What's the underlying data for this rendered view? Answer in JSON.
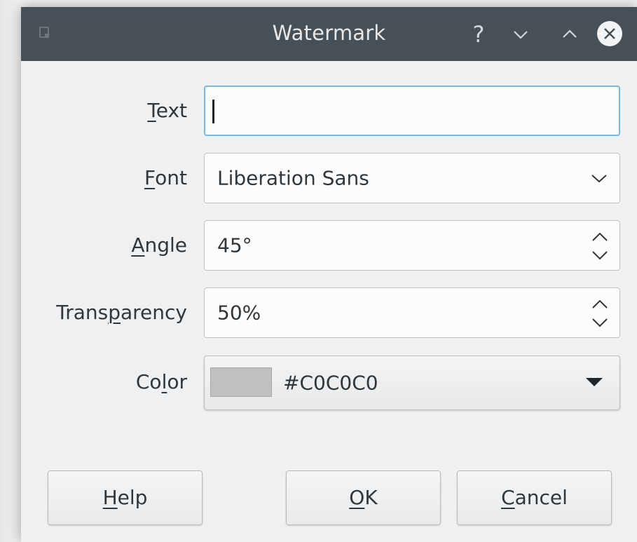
{
  "window": {
    "title": "Watermark",
    "controls": {
      "help": "?",
      "minimize": "⌄",
      "maximize": "⌃"
    }
  },
  "form": {
    "text": {
      "label_mnemonic": "T",
      "label_rest": "ext",
      "value": ""
    },
    "font": {
      "label_mnemonic": "F",
      "label_rest": "ont",
      "value": "Liberation Sans"
    },
    "angle": {
      "label_mnemonic": "A",
      "label_rest": "ngle",
      "value": "45°"
    },
    "transparency": {
      "label_pre": "Trans",
      "label_mnemonic": "p",
      "label_rest": "arency",
      "value": "50%"
    },
    "color": {
      "label_pre": "Co",
      "label_mnemonic": "l",
      "label_rest": "or",
      "value": "#C0C0C0",
      "swatch": "#C0C0C0"
    }
  },
  "buttons": {
    "help": {
      "mnemonic": "H",
      "rest": "elp"
    },
    "ok": {
      "mnemonic": "O",
      "rest": "K"
    },
    "cancel": {
      "mnemonic": "C",
      "rest": "ancel"
    }
  },
  "colors": {
    "titlebar": "#475057",
    "focus_border": "#79b5dc",
    "background": "#eff0f1"
  }
}
